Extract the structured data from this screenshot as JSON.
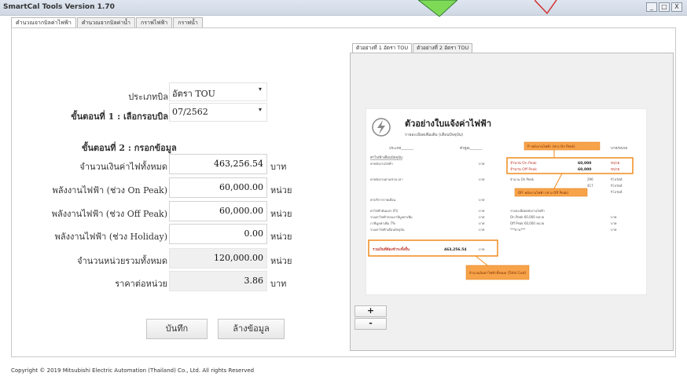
{
  "window": {
    "title": "SmartCal Tools Version 1.70",
    "minimize_glyph": "_",
    "maximize_glyph": "□",
    "close_glyph": "X"
  },
  "tabs": [
    {
      "label": "คำนวณจากบิลค่าไฟฟ้า"
    },
    {
      "label": "คำนวณจากบิลค่าน้ำ"
    },
    {
      "label": "กราฟไฟฟ้า"
    },
    {
      "label": "กราฟน้ำ"
    }
  ],
  "form": {
    "bill_type_label": "ประเภทบิล",
    "bill_type_value": "อัตรา TOU",
    "step1_label": "ขั้นตอนที่ 1 : เลือกรอบบิล",
    "bill_cycle_value": "07/2562",
    "step2_label": "ขั้นตอนที่ 2 : กรอกข้อมูล",
    "rows": [
      {
        "label": "จำนวนเงินค่าไฟทั้งหมด",
        "value": "463,256.54",
        "unit": "บาท"
      },
      {
        "label": "พลังงานไฟฟ้า (ช่วง On Peak)",
        "value": "60,000.00",
        "unit": "หน่วย"
      },
      {
        "label": "พลังงานไฟฟ้า (ช่วง Off Peak)",
        "value": "60,000.00",
        "unit": "หน่วย"
      },
      {
        "label": "พลังงานไฟฟ้า (ช่วง Holiday)",
        "value": "0.00",
        "unit": "หน่วย"
      },
      {
        "label": "จำนวนหน่วยรวมทั้งหมด",
        "value": "120,000.00",
        "unit": "หน่วย"
      },
      {
        "label": "ราคาต่อหน่วย",
        "value": "3.86",
        "unit": "บาท"
      }
    ],
    "save_label": "บันทึก",
    "clear_label": "ล้างข้อมูล"
  },
  "sample": {
    "tabs": [
      {
        "label": "ตัวอย่างที่ 1 อัตรา TOU"
      },
      {
        "label": "ตัวอย่างที่ 2 อัตรา TOU"
      }
    ],
    "bill_title": "ตัวอย่างใบแจ้งค่าไฟฟ้า",
    "bill_subtitle": "รายละเอียดเพิ่มเติม (เดือนปัจจุบัน)",
    "header_left": "ประเภท_______",
    "header_mid": "ตัวคูณ_______",
    "header_right": "บาท/หน่วย",
    "section_label": "ค่าไฟฟ้าเดือนปัจจุบัน",
    "left_rows": [
      "ค่าพลังงานไฟฟ้า",
      "ค่าพลังงานตามช่วงเวลา",
      "ค่าบริการรายเดือน",
      "ค่าไฟฟ้าผันแปร (Ft)",
      "รวมค่าไฟฟ้าก่อนภาษีมูลค่าเพิ่ม",
      "ภาษีมูลค่าเพิ่ม 7%",
      "รวมค่าไฟฟ้าเดือนปัจจุบัน"
    ],
    "unit_baht": "บาท",
    "on_peak_row": "จำนวน On Peak",
    "off_peak_row": "จำนวน Off Peak",
    "on_peak_amount": "60,000",
    "off_peak_amount": "60,000",
    "unit_word": "หน่วย",
    "on_peak2_row": "จำนวน On Peak",
    "on_peak2_amount": "296",
    "kw_unit": "กิโลวัตต์",
    "kw_amount": "417",
    "right_note": "รายละเอียดพลังงานไฟฟ้า",
    "right_onpeak": "On Peak 60,000 หน่วย",
    "right_offpeak": "Off Peak 60,000 หน่วย",
    "right_star": "***ผ่าน***",
    "total_label": "รวมเงินที่ต้องชำระทั้งสิ้น",
    "total_value": "463,256.54",
    "callout_onpeak": "P: พลังงานไฟฟ้า (ช่วง On Peak)",
    "callout_offpeak": "OP: พลังงานไฟฟ้า (ช่วง Off Peak)",
    "callout_total": "จำนวนเงินค่าไฟฟ้าทั้งหมด (Total Cost)",
    "zoom_in": "+",
    "zoom_out": "-"
  },
  "footer": "Copyright © 2019 Mitsubishi Electric Automation (Thailand) Co., Ltd. All rights Reserved",
  "colors": {
    "accent_orange": "#f08c1e",
    "callout_fill": "#f7a34a",
    "arrow_green": "#7ed957"
  }
}
